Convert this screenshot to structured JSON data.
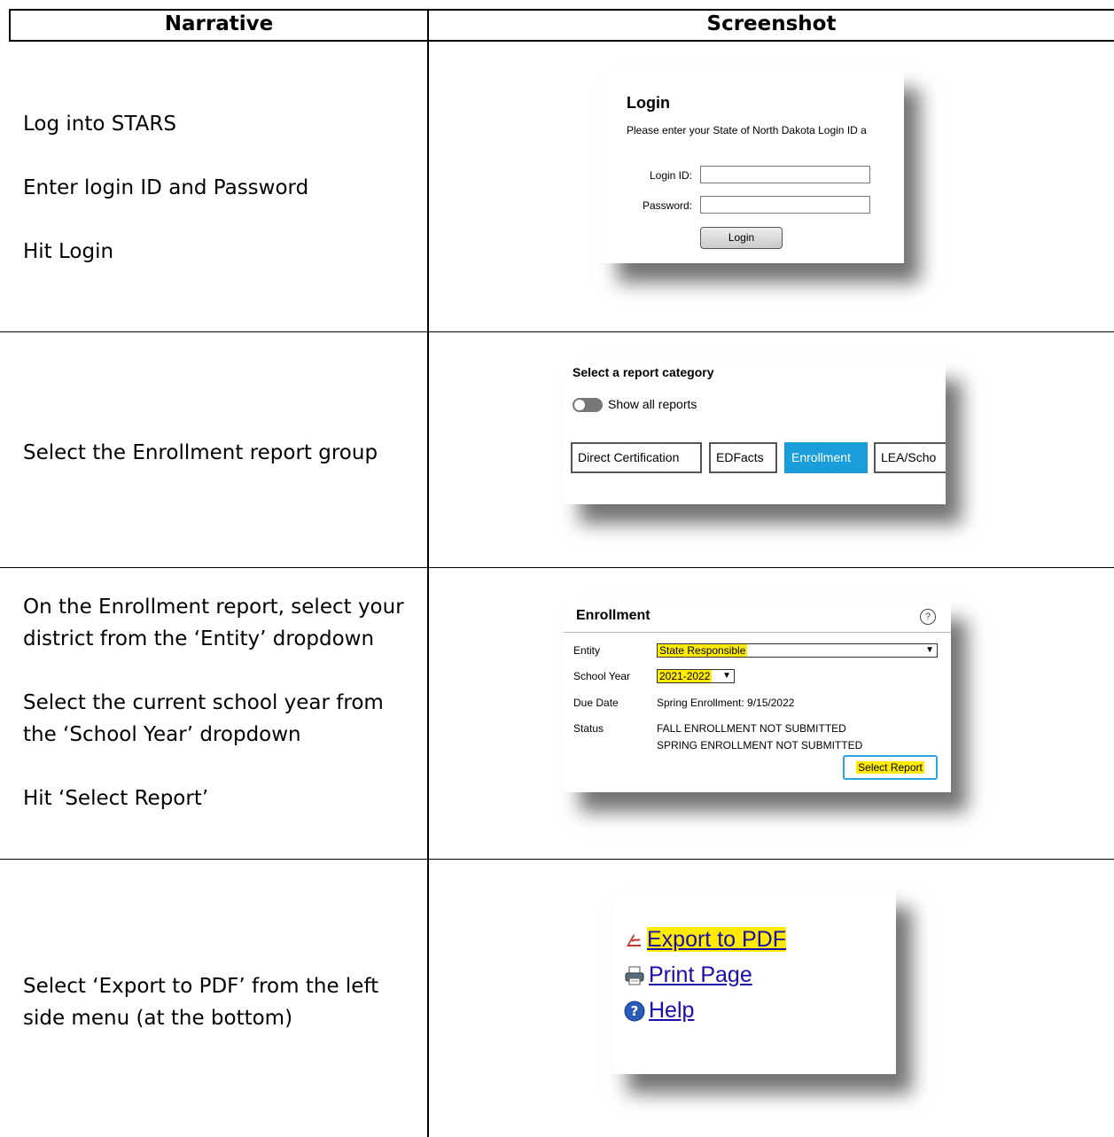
{
  "table": {
    "headers": [
      "Narrative",
      "Screenshot"
    ]
  },
  "rows": [
    {
      "narrative": [
        "Log into STARS",
        "Enter login ID and Password",
        "Hit Login"
      ],
      "login": {
        "title": "Login",
        "subtitle": "Please enter your State of North Dakota Login ID a",
        "login_id_label": "Login ID:",
        "password_label": "Password:",
        "button": "Login"
      }
    },
    {
      "narrative": [
        "Select the Enrollment report group"
      ],
      "category": {
        "title": "Select a report category",
        "toggle_label": "Show all reports",
        "buttons": [
          "Direct Certification",
          "EDFacts",
          "Enrollment",
          "LEA/Scho"
        ],
        "active": "Enrollment",
        "active_color": "#1a9edb"
      }
    },
    {
      "narrative": [
        "On the Enrollment report, select your district from the ‘Entity’ dropdown",
        "Select the current school year from the ‘School Year’ dropdown",
        "Hit ‘Select Report’"
      ],
      "enrollment": {
        "title": "Enrollment",
        "help_icon": "question-circle-icon",
        "entity_label": "Entity",
        "entity_value": "State Responsible",
        "school_year_label": "School Year",
        "school_year_value": "2021-2022",
        "due_date_label": "Due Date",
        "due_date_value": "Spring Enrollment: 9/15/2022",
        "status_label": "Status",
        "status_lines": [
          "FALL ENROLLMENT NOT SUBMITTED",
          "SPRING ENROLLMENT NOT SUBMITTED"
        ],
        "select_button": "Select Report",
        "highlight_color": "#ffeb00"
      }
    },
    {
      "narrative": [
        "Select ‘Export to PDF’ from the left side menu (at the bottom)"
      ],
      "menu": {
        "items": [
          {
            "label": "Export to PDF",
            "icon": "pdf-icon"
          },
          {
            "label": "Print Page",
            "icon": "printer-icon"
          },
          {
            "label": "Help",
            "icon": "help-icon"
          }
        ]
      }
    }
  ]
}
